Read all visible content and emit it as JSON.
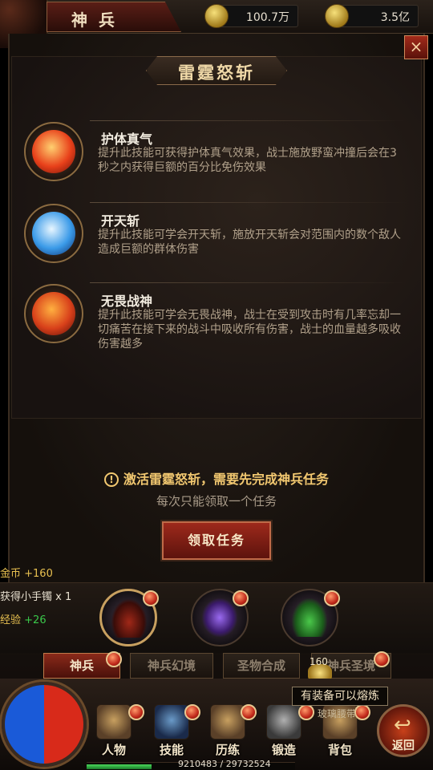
{
  "header": {
    "title": "神兵",
    "gold": "100.7万",
    "ingot": "3.5亿"
  },
  "panel": {
    "close_label": "×",
    "banner": "雷霆怒斩",
    "skills": [
      {
        "name": "护体真气",
        "desc": "提升此技能可获得护体真气效果，战士施放野蛮冲撞后会在3秒之内获得巨额的百分比免伤效果",
        "icon": "fire-runner-icon"
      },
      {
        "name": "开天斩",
        "desc": "提升此技能可学会开天斩，施放开天斩会对范围内的数个敌人造成巨额的群体伤害",
        "icon": "ice-blade-icon"
      },
      {
        "name": "无畏战神",
        "desc": "提升此技能可学会无畏战神，战士在受到攻击时有几率忘却一切痛苦在接下来的战斗中吸收所有伤害，战士的血量越多吸收伤害越多",
        "icon": "flame-spirit-icon"
      }
    ],
    "warning": "激活雷霆怒斩，需要先完成神兵任务",
    "warning_icon": "!",
    "subtext": "每次只能领取一个任务",
    "receive_button": "领取任务"
  },
  "log": {
    "gold": "金币  +160",
    "item": "获得小手镯 x 1",
    "exp_label": "经验",
    "exp_value": "+26"
  },
  "weapons": [
    "scythe-weapon",
    "purple-blade-weapon",
    "green-fan-weapon"
  ],
  "subtabs": [
    "神兵",
    "神兵幻境",
    "圣物合成",
    "神兵圣境"
  ],
  "gold_pile": {
    "count": "160"
  },
  "tooltip": {
    "text": "有装备可以熔炼",
    "sub": "玻璃腰带"
  },
  "nav": [
    {
      "label": "人物",
      "icon": "helmet-icon"
    },
    {
      "label": "技能",
      "icon": "skill-book-icon"
    },
    {
      "label": "历练",
      "icon": "armor-icon"
    },
    {
      "label": "锻造",
      "icon": "anvil-icon"
    },
    {
      "label": "背包",
      "icon": "bag-icon"
    }
  ],
  "back_label": "返回",
  "exp": {
    "text": "9210483 / 29732524",
    "fraction": 0.31
  },
  "colors": {
    "accent_red": "#a02a1c",
    "gold_text": "#f2c870",
    "exp_green": "#3ac84a"
  }
}
